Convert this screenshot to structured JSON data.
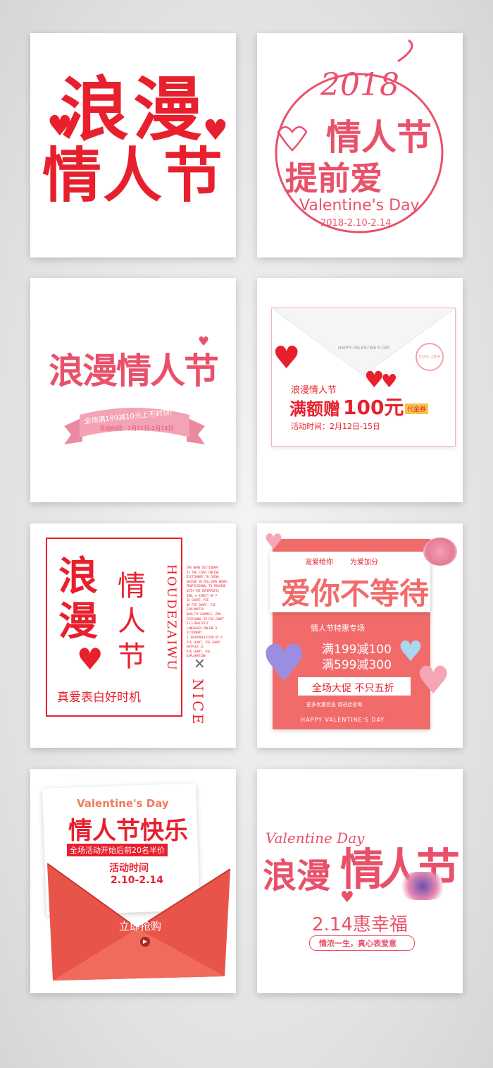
{
  "cards": {
    "c1": {
      "line1": "浪漫",
      "line2": "情人节"
    },
    "c2": {
      "year": "2018",
      "title": "情人节",
      "sub": "提前爱",
      "en": "Valentine's Day",
      "date": "2018-2.10-2.14"
    },
    "c3": {
      "title": "浪漫情人节",
      "ribbon": "全场满199减10元上不封顶!",
      "date": "活动时间：2月11日-2月14日"
    },
    "c4": {
      "stamp": "50% OFF",
      "small": "HAPPY VALENTINE'S DAY",
      "title": "浪漫情人节",
      "main": "满额赠",
      "amount": "100元",
      "coupon": "代金券",
      "date": "活动时间：2月12日-15日"
    },
    "c5": {
      "c1": "浪",
      "c2": "漫",
      "c3": "情",
      "c4": "人",
      "c5": "节",
      "vert1": "HOUDEZAIWU",
      "vert2": "NICE",
      "x": "×",
      "caption": "真爱表白好时机",
      "small_text": [
        "THE WORD DICTIONARY",
        "IS THE FIRST ONLINE",
        "DICTIONARY IN CHINA",
        "UNIQUE IN MILLIONS WORDS",
        "PROFESSIONAL TO PROVIDE",
        "WITH THE INTERPRETA",
        "ION, A ASPECT OF P",
        "IE CHART, PIE",
        "OR PIE CHART, PIE",
        "EXPLANATIO",
        "QUALITY EXAMPLE, PRO",
        "FESSIONAL TO PIE CHART",
        "13 LINGUISTIC",
        "LANGUAGES ONLINE D",
        "ICTIONARY",
        "2 INTERPRETATION OF A",
        "PIE CHART, PIE CHART",
        "ENTRIES 11",
        "PIE CHART, PIE",
        "EXPLANATION"
      ]
    },
    "c6": {
      "tag1": "宠爱给你",
      "tag2": "为爱加分",
      "title": "爱你不等待",
      "band": "情人节特惠专场",
      "offer1a": "满199",
      "offer1b": "减100",
      "offer2a": "满599",
      "offer2b": "减300",
      "promo": "全场大促 不只五折",
      "more": "更多优惠信息 请进店咨询",
      "footer": "HAPPY VALENTINE'S DAY"
    },
    "c7": {
      "en": "Valentine's Day",
      "title": "情人节快乐",
      "bar": "全场活动开始后前20名半价",
      "time_label": "活动时间",
      "time": "2.10-2.14",
      "button": "立即抢购"
    },
    "c8": {
      "en": "Valentine Day",
      "title1": "浪漫",
      "title2": "情人节",
      "sub": "2.14惠幸福",
      "slogan": "情浓一生，真心表爱意"
    }
  },
  "colors": {
    "red": "#e8202e",
    "pink": "#e9516b",
    "coral": "#f26b6b"
  }
}
